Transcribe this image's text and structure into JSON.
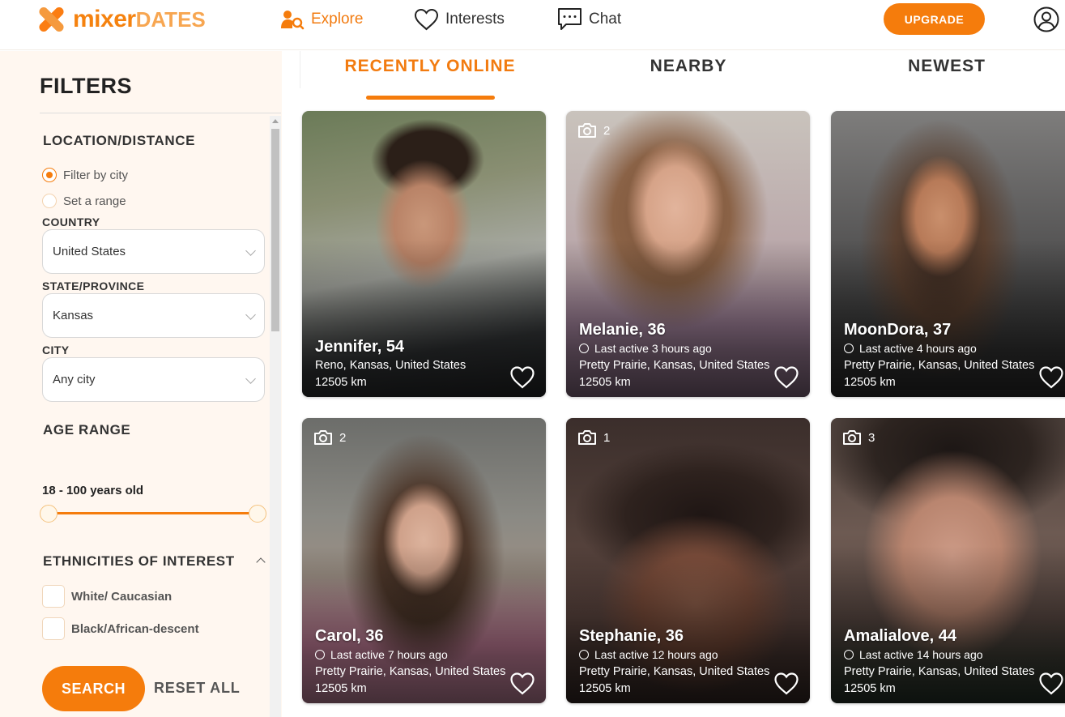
{
  "brand": {
    "part1": "mixer",
    "part2": "DATES"
  },
  "nav": {
    "explore": "Explore",
    "interests": "Interests",
    "chat": "Chat",
    "upgrade": "UPGRADE"
  },
  "filters": {
    "title": "FILTERS",
    "location_title": "LOCATION/DISTANCE",
    "radio_city": "Filter by city",
    "radio_range": "Set a range",
    "selected_mode": "Filter by city",
    "country_label": "COUNTRY",
    "country_value": "United States",
    "state_label": "STATE/PROVINCE",
    "state_value": "Kansas",
    "city_label": "CITY",
    "city_value": "Any city",
    "age_title": "AGE RANGE",
    "age_value": "18 - 100 years old",
    "age_min": 18,
    "age_max": 100,
    "ethnicity_title": "ETHNICITIES OF INTEREST",
    "ethnicities": [
      "White/ Caucasian",
      "Black/African-descent"
    ],
    "search_label": "SEARCH",
    "reset_label": "RESET ALL"
  },
  "tabs": [
    "RECENTLY ONLINE",
    "NEARBY",
    "NEWEST"
  ],
  "active_tab": "RECENTLY ONLINE",
  "profiles": [
    {
      "name": "Jennifer, 54",
      "photos": "",
      "last_active": "",
      "location": "Reno, Kansas, United States",
      "distance": "12505 km"
    },
    {
      "name": "Melanie, 36",
      "photos": "2",
      "last_active": "Last active 3 hours ago",
      "location": "Pretty Prairie, Kansas, United States",
      "distance": "12505 km"
    },
    {
      "name": "MoonDora, 37",
      "photos": "",
      "last_active": "Last active 4 hours ago",
      "location": "Pretty Prairie, Kansas, United States",
      "distance": "12505 km"
    },
    {
      "name": "Carol, 36",
      "photos": "2",
      "last_active": "Last active 7 hours ago",
      "location": "Pretty Prairie, Kansas, United States",
      "distance": "12505 km"
    },
    {
      "name": "Stephanie, 36",
      "photos": "1",
      "last_active": "Last active 12 hours ago",
      "location": "Pretty Prairie, Kansas, United States",
      "distance": "12505 km"
    },
    {
      "name": "Amalialove, 44",
      "photos": "3",
      "last_active": "Last active 14 hours ago",
      "location": "Pretty Prairie, Kansas, United States",
      "distance": "12505 km"
    }
  ],
  "colors": {
    "accent": "#f57c0c",
    "sidebar_bg": "#fff7f0"
  }
}
